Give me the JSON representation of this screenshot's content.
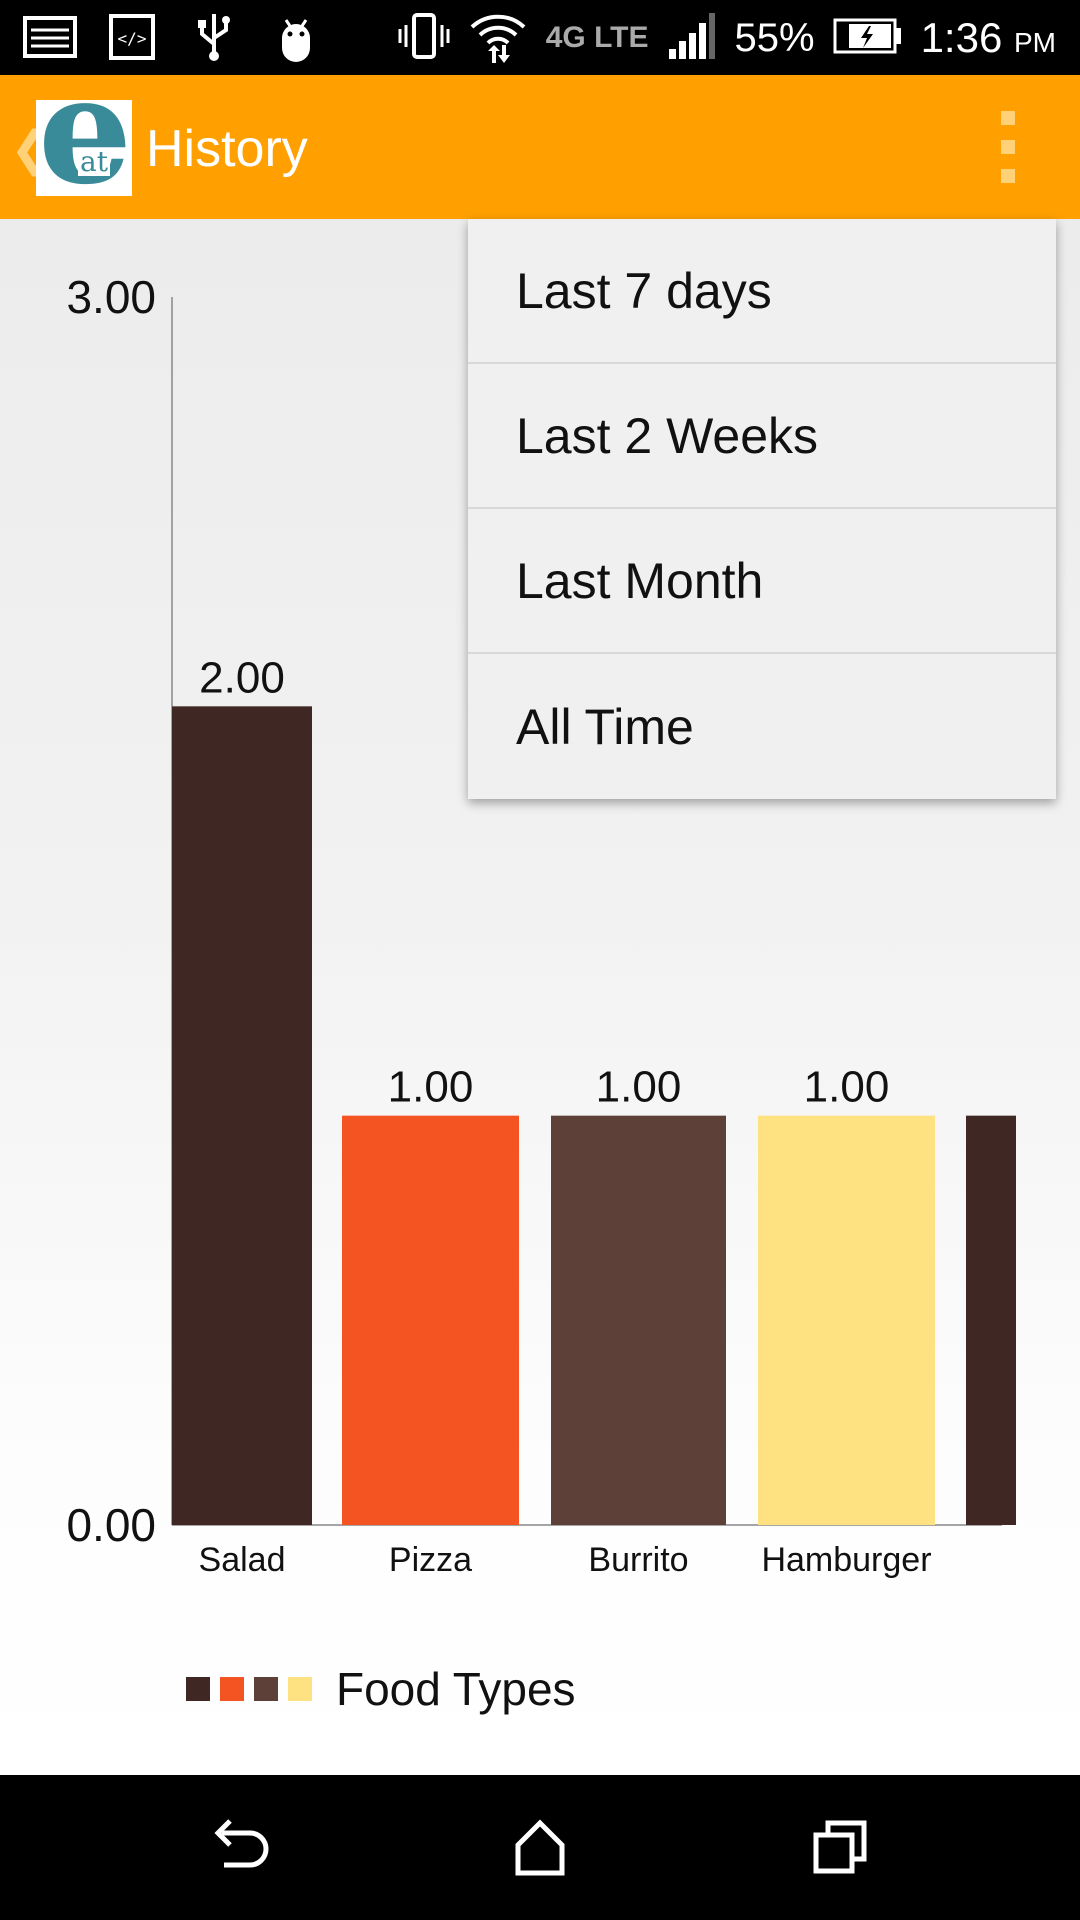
{
  "status_bar": {
    "battery": "55%",
    "time": "1:36",
    "ampm": "PM",
    "network": "4G LTE",
    "icons": [
      "image-icon",
      "code-icon",
      "usb-icon",
      "android-icon",
      "vibrate-icon",
      "wifi-icon",
      "signal-icon",
      "battery-charging-icon"
    ]
  },
  "app_bar": {
    "title": "History",
    "logo_letter": "e",
    "logo_sub": "at",
    "logo_color": "#3a8b99",
    "bar_color": "#ffa000"
  },
  "menu": {
    "items": [
      {
        "label": "Last 7 days"
      },
      {
        "label": "Last 2 Weeks"
      },
      {
        "label": "Last Month"
      },
      {
        "label": "All Time"
      }
    ]
  },
  "chart_data": {
    "type": "bar",
    "categories": [
      "Salad",
      "Pizza",
      "Burrito",
      "Hamburger",
      ""
    ],
    "values": [
      2,
      1,
      1,
      1,
      1
    ],
    "value_labels": [
      "2.00",
      "1.00",
      "1.00",
      "1.00",
      ""
    ],
    "colors": [
      "#3f2723",
      "#f45322",
      "#5d4038",
      "#fee281",
      "#3f2723"
    ],
    "ylim": [
      0,
      3
    ],
    "y_tick_labels": [
      "0.00",
      "3.00"
    ],
    "legend": "Food Types",
    "legend_colors": [
      "#3f2723",
      "#f45322",
      "#5d4038",
      "#fee281"
    ],
    "legend_placement": "bottom-left"
  }
}
